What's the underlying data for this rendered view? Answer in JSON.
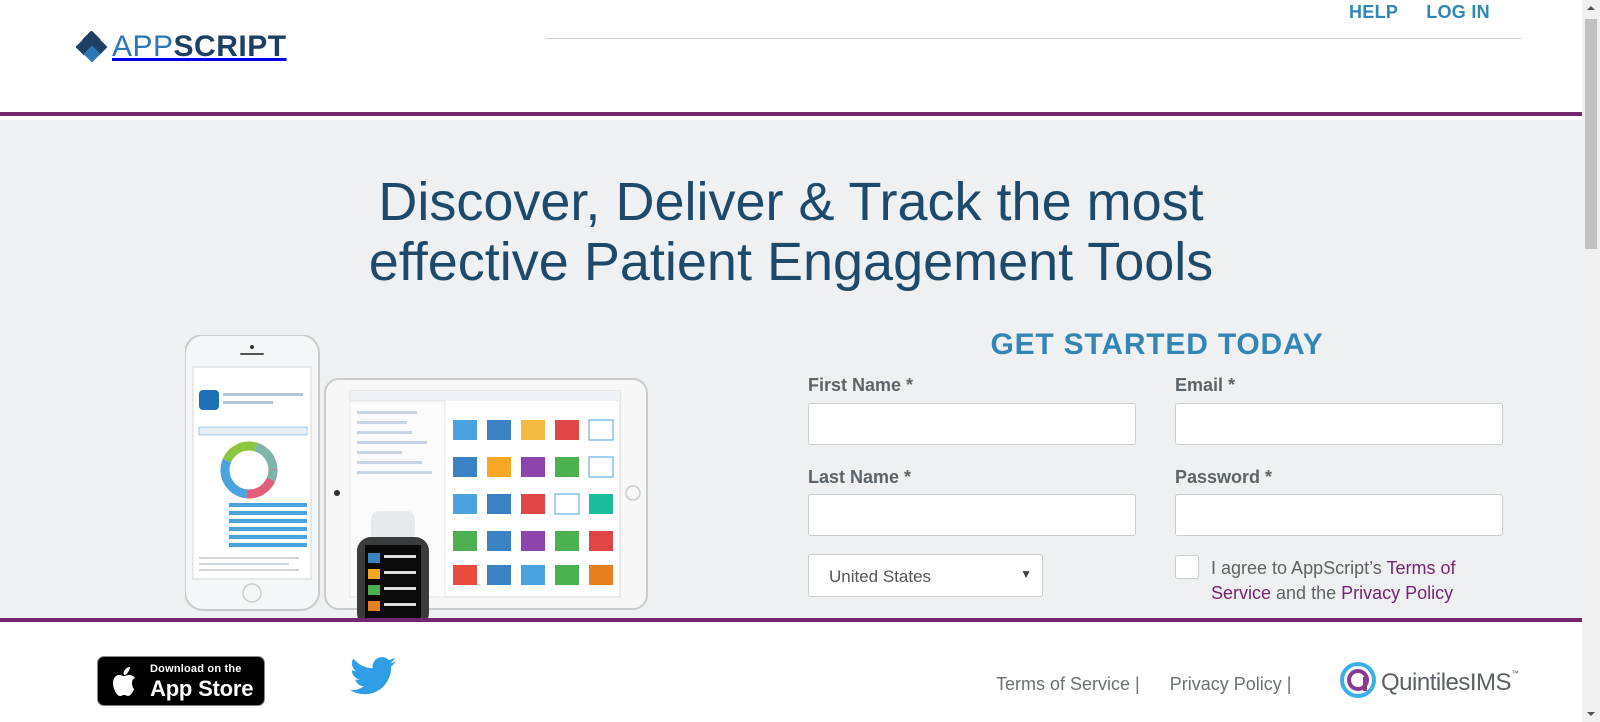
{
  "header": {
    "logo_app": "APP",
    "logo_script": "SCRIPT",
    "nav": [
      {
        "label": "HELP"
      },
      {
        "label": "LOG IN"
      }
    ]
  },
  "hero": {
    "headline_line1": "Discover, Deliver & Track the most",
    "headline_line2": "effective Patient Engagement Tools"
  },
  "form": {
    "title": "GET STARTED TODAY",
    "first_name_label": "First Name *",
    "email_label": "Email *",
    "last_name_label": "Last Name *",
    "password_label": "Password *",
    "first_name_value": "",
    "email_value": "",
    "last_name_value": "",
    "password_value": "",
    "country_value": "United States",
    "agree_prefix": "I agree to AppScript’s ",
    "terms_link": "Terms of Service",
    "agree_middle": " and the ",
    "privacy_link": "Privacy Policy",
    "agree_checked": false
  },
  "footer": {
    "appstore_small": "Download on the",
    "appstore_big": "App Store",
    "links": [
      {
        "label": "Terms of Service |"
      },
      {
        "label": "Privacy Policy |"
      }
    ],
    "partner_name": "QuintilesIMS",
    "partner_tm": "™"
  },
  "colors": {
    "brand_purple": "#76256f",
    "brand_blue": "#3285b5",
    "headline_navy": "#1d4a6b",
    "hero_bg": "#eef0f2"
  },
  "icons": [
    "appscript-logo-icon",
    "apple-icon",
    "twitter-icon",
    "quintilesims-logo-icon",
    "select-arrow-icon"
  ]
}
